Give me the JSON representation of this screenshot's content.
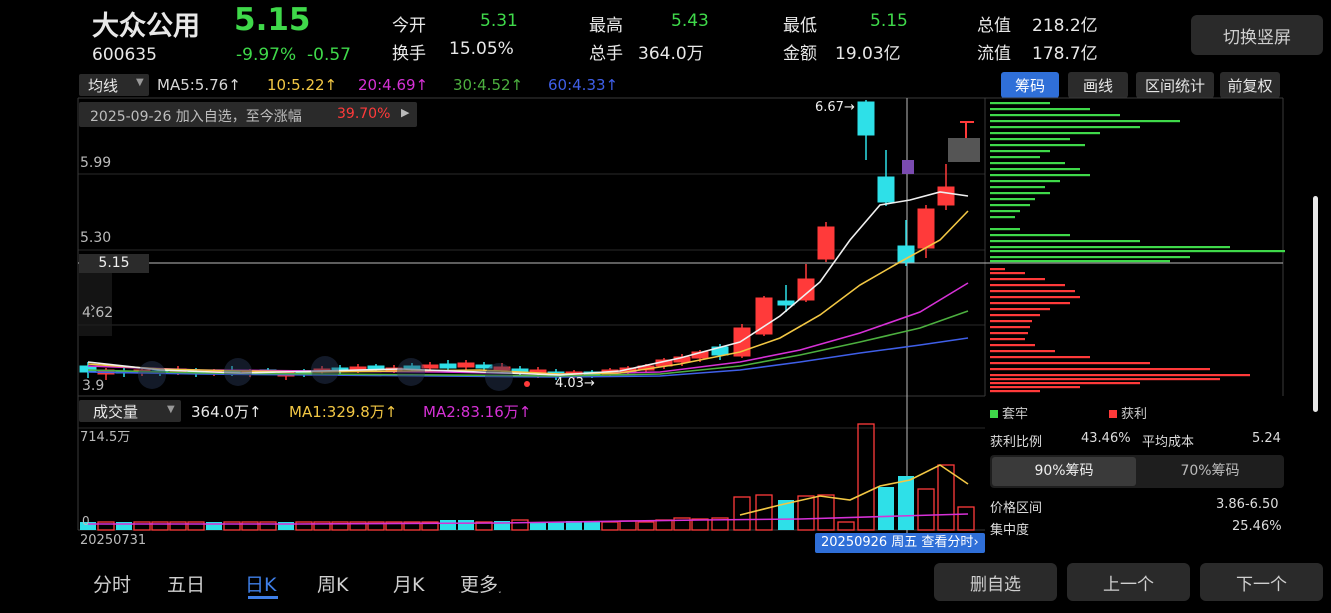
{
  "header": {
    "name": "大众公用",
    "price": "5.15",
    "code": "600635",
    "change_pct": "-9.97%",
    "change_abs": "-0.57",
    "stats": [
      {
        "label": "今开",
        "value": "5.31"
      },
      {
        "label": "最高",
        "value": "5.43"
      },
      {
        "label": "最低",
        "value": "5.15"
      },
      {
        "label": "总值",
        "value": "218.2亿"
      },
      {
        "label": "换手",
        "value": "15.05%"
      },
      {
        "label": "总手",
        "value": "364.0万"
      },
      {
        "label": "金额",
        "value": "19.03亿"
      },
      {
        "label": "流值",
        "value": "178.7亿"
      }
    ],
    "switch_button": "切换竖屏"
  },
  "ma_bar": {
    "selector": "均线",
    "items": [
      {
        "text": "MA5:5.76↑",
        "color": "#ffffff"
      },
      {
        "text": "10:5.22↑",
        "color": "#f2c744"
      },
      {
        "text": "20:4.69↑",
        "color": "#d631d6"
      },
      {
        "text": "30:4.52↑",
        "color": "#4caf3f"
      },
      {
        "text": "60:4.33↑",
        "color": "#3f5fe8"
      }
    ]
  },
  "watch_note": {
    "text": "2025-09-26 加入自选，至今涨幅",
    "pct": "39.70%"
  },
  "price_axis": {
    "p1": "5.99",
    "p2": "5.30",
    "p3": "5.15",
    "p4": "4.62",
    "p5": "3.9"
  },
  "chart_labels": {
    "high_label": "6.67",
    "low_label": "4.03"
  },
  "right_tabs": [
    "筹码",
    "画线",
    "区间统计",
    "前复权"
  ],
  "volume_bar": {
    "selector": "成交量",
    "vol": "364.0万↑",
    "ma1": "MA1:329.8万↑",
    "ma2": "MA2:83.16万↑",
    "axis_top": "714.5万",
    "axis_zero": "0"
  },
  "date_start": "20250731",
  "date_tip": "20250926 周五 查看分时",
  "chips": {
    "legend_trap": "套牢",
    "legend_profit": "获利",
    "profit_ratio_label": "获利比例",
    "profit_ratio": "43.46%",
    "avg_cost_label": "平均成本",
    "avg_cost": "5.24",
    "tab_90": "90%筹码",
    "tab_70": "70%筹码",
    "range_label": "价格区间",
    "range": "3.86-6.50",
    "conc_label": "集中度",
    "conc": "25.46%"
  },
  "bottom_tabs": [
    "分时",
    "五日",
    "日K",
    "周K",
    "月K",
    "更多"
  ],
  "bottom_buttons": [
    "删自选",
    "上一个",
    "下一个"
  ],
  "colors": {
    "up": "#ff3a3a",
    "down": "#3fd94a",
    "candle_down": "#2ee0e8",
    "active_blue": "#2f6fd8"
  }
}
